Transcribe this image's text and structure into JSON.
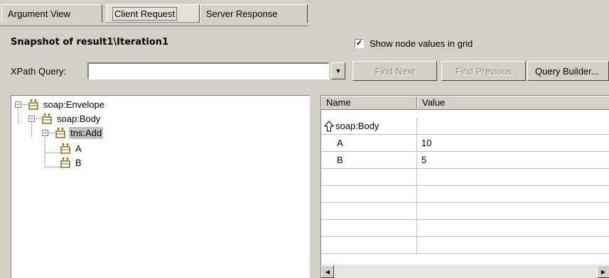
{
  "tabs": [
    {
      "label": "Argument View",
      "active": false
    },
    {
      "label": "Client Request",
      "active": true
    },
    {
      "label": "Server Response",
      "active": false
    }
  ],
  "snapshot_title": "Snapshot of result1\\Iteration1",
  "show_values": {
    "label": "Show node values in grid",
    "checked": true,
    "mark": "✓"
  },
  "xpath": {
    "label": "XPath Query:",
    "value": "",
    "dropdown_glyph": "▼"
  },
  "buttons": {
    "find_next": "Find Next",
    "find_previous": "Find Previous",
    "query_builder": "Query Builder..."
  },
  "tree": {
    "nodes": [
      {
        "label": "soap:Envelope",
        "expander": "−"
      },
      {
        "label": "soap:Body",
        "expander": "−"
      },
      {
        "label": "tns:Add",
        "expander": "−",
        "selected": true
      },
      {
        "label": "A"
      },
      {
        "label": "B"
      }
    ]
  },
  "grid": {
    "columns": [
      "Name",
      "Value"
    ],
    "parent_row": {
      "name": "soap:Body",
      "value": ""
    },
    "rows": [
      {
        "name": "A",
        "value": "10"
      },
      {
        "name": "B",
        "value": "5"
      }
    ],
    "scroll_left": "◀",
    "scroll_right": "▶"
  },
  "colors": {
    "face": "#d4d0c8",
    "selection": "#c0c0c0",
    "icon": "#8a6a10"
  }
}
